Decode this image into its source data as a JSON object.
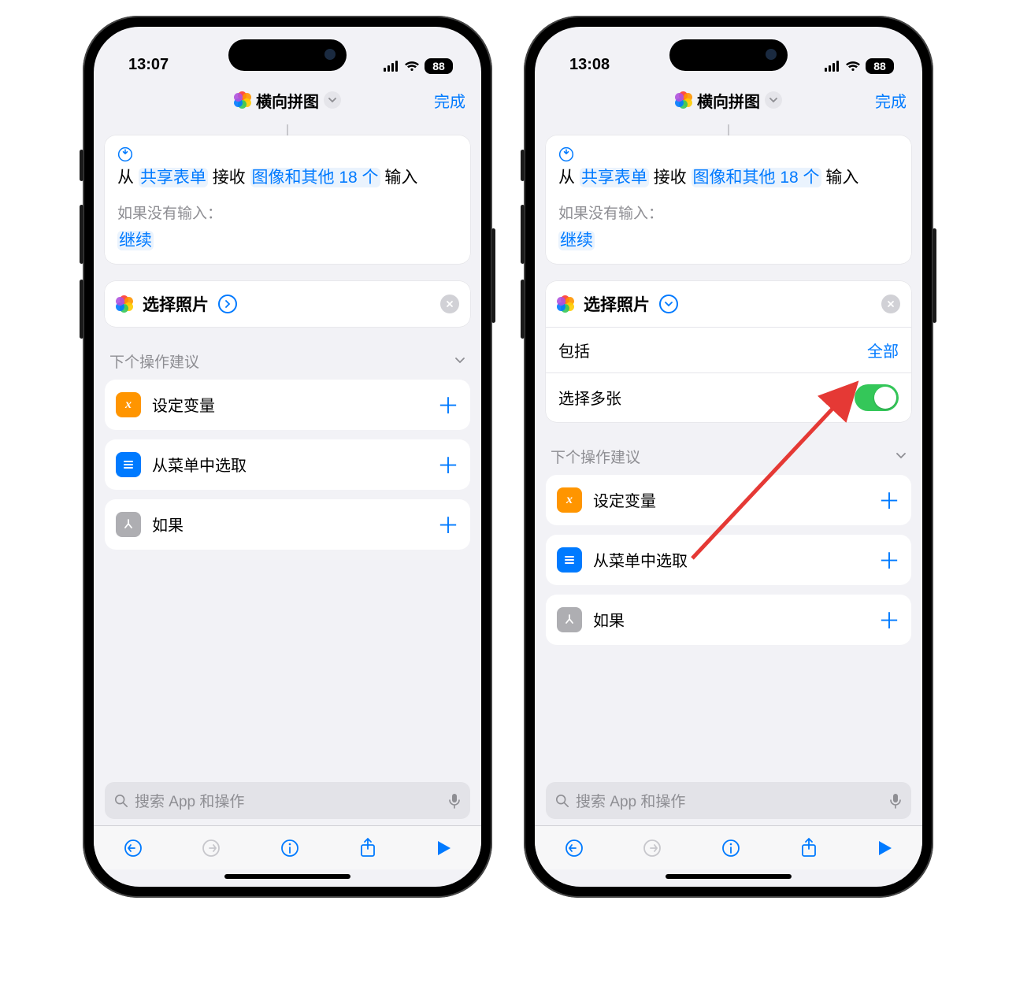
{
  "left": {
    "status": {
      "time": "13:07",
      "battery": "88"
    },
    "nav": {
      "title": "横向拼图",
      "done": "完成"
    },
    "input_block": {
      "from": "从",
      "share_sheet": "共享表单",
      "receive": "接收",
      "types": "图像和其他 18 个",
      "input_word": "输入",
      "no_input_label": "如果没有输入：",
      "continue": "继续"
    },
    "action": {
      "title": "选择照片"
    },
    "suggestions_header": "下个操作建议",
    "suggestions": [
      {
        "label": "设定变量",
        "color": "orange",
        "glyph": "x"
      },
      {
        "label": "从菜单中选取",
        "color": "blue",
        "glyph": "menu"
      },
      {
        "label": "如果",
        "color": "gray",
        "glyph": "branch"
      }
    ],
    "search_placeholder": "搜索 App 和操作"
  },
  "right": {
    "status": {
      "time": "13:08",
      "battery": "88"
    },
    "nav": {
      "title": "横向拼图",
      "done": "完成"
    },
    "input_block": {
      "from": "从",
      "share_sheet": "共享表单",
      "receive": "接收",
      "types": "图像和其他 18 个",
      "input_word": "输入",
      "no_input_label": "如果没有输入：",
      "continue": "继续"
    },
    "action": {
      "title": "选择照片",
      "opts": {
        "include_label": "包括",
        "include_value": "全部",
        "multi_label": "选择多张",
        "multi_on": true
      }
    },
    "suggestions_header": "下个操作建议",
    "suggestions": [
      {
        "label": "设定变量",
        "color": "orange",
        "glyph": "x"
      },
      {
        "label": "从菜单中选取",
        "color": "blue",
        "glyph": "menu"
      },
      {
        "label": "如果",
        "color": "gray",
        "glyph": "branch"
      }
    ],
    "search_placeholder": "搜索 App 和操作"
  }
}
